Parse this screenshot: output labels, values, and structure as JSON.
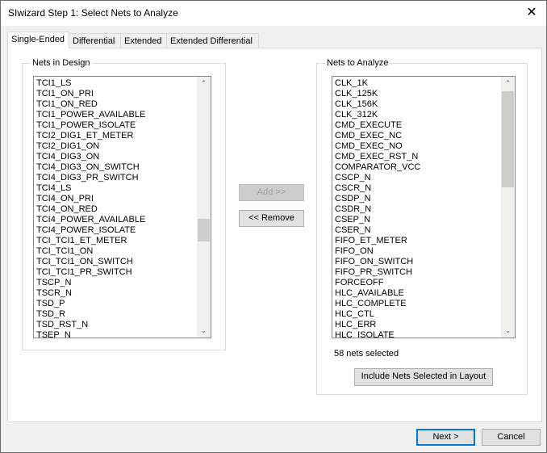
{
  "window": {
    "title": "SIwizard Step 1: Select Nets to Analyze",
    "close_icon": "close-icon"
  },
  "tabs": [
    {
      "label": "Single-Ended",
      "selected": true
    },
    {
      "label": "Differential"
    },
    {
      "label": "Extended"
    },
    {
      "label": "Extended Differential"
    }
  ],
  "left": {
    "label": "Nets in Design",
    "items": [
      "TCI1_LS",
      "TCI1_ON_PRI",
      "TCI1_ON_RED",
      "TCI1_POWER_AVAILABLE",
      "TCI1_POWER_ISOLATE",
      "TCI2_DIG1_ET_METER",
      "TCI2_DIG1_ON",
      "TCI4_DIG3_ON",
      "TCI4_DIG3_ON_SWITCH",
      "TCI4_DIG3_PR_SWITCH",
      "TCI4_LS",
      "TCI4_ON_PRI",
      "TCI4_ON_RED",
      "TCI4_POWER_AVAILABLE",
      "TCI4_POWER_ISOLATE",
      "TCI_TCI1_ET_METER",
      "TCI_TCI1_ON",
      "TCI_TCI1_ON_SWITCH",
      "TCI_TCI1_PR_SWITCH",
      "TSCP_N",
      "TSCR_N",
      "TSD_P",
      "TSD_R",
      "TSD_RST_N",
      "TSEP_N"
    ]
  },
  "middle": {
    "add": "Add >>",
    "remove": "<< Remove"
  },
  "right": {
    "label": "Nets to Analyze",
    "items": [
      "CLK_1K",
      "CLK_125K",
      "CLK_156K",
      "CLK_312K",
      "CMD_EXECUTE",
      "CMD_EXEC_NC",
      "CMD_EXEC_NO",
      "CMD_EXEC_RST_N",
      "COMPARATOR_VCC",
      "CSCP_N",
      "CSCR_N",
      "CSDP_N",
      "CSDR_N",
      "CSEP_N",
      "CSER_N",
      "FIFO_ET_METER",
      "FIFO_ON",
      "FIFO_ON_SWITCH",
      "FIFO_PR_SWITCH",
      "FORCEOFF",
      "HLC_AVAILABLE",
      "HLC_COMPLETE",
      "HLC_CTL",
      "HLC_ERR",
      "HLC_ISOLATE"
    ],
    "count": "58 nets selected",
    "include": "Include Nets Selected in Layout"
  },
  "footer": {
    "next": "Next >",
    "cancel": "Cancel"
  }
}
